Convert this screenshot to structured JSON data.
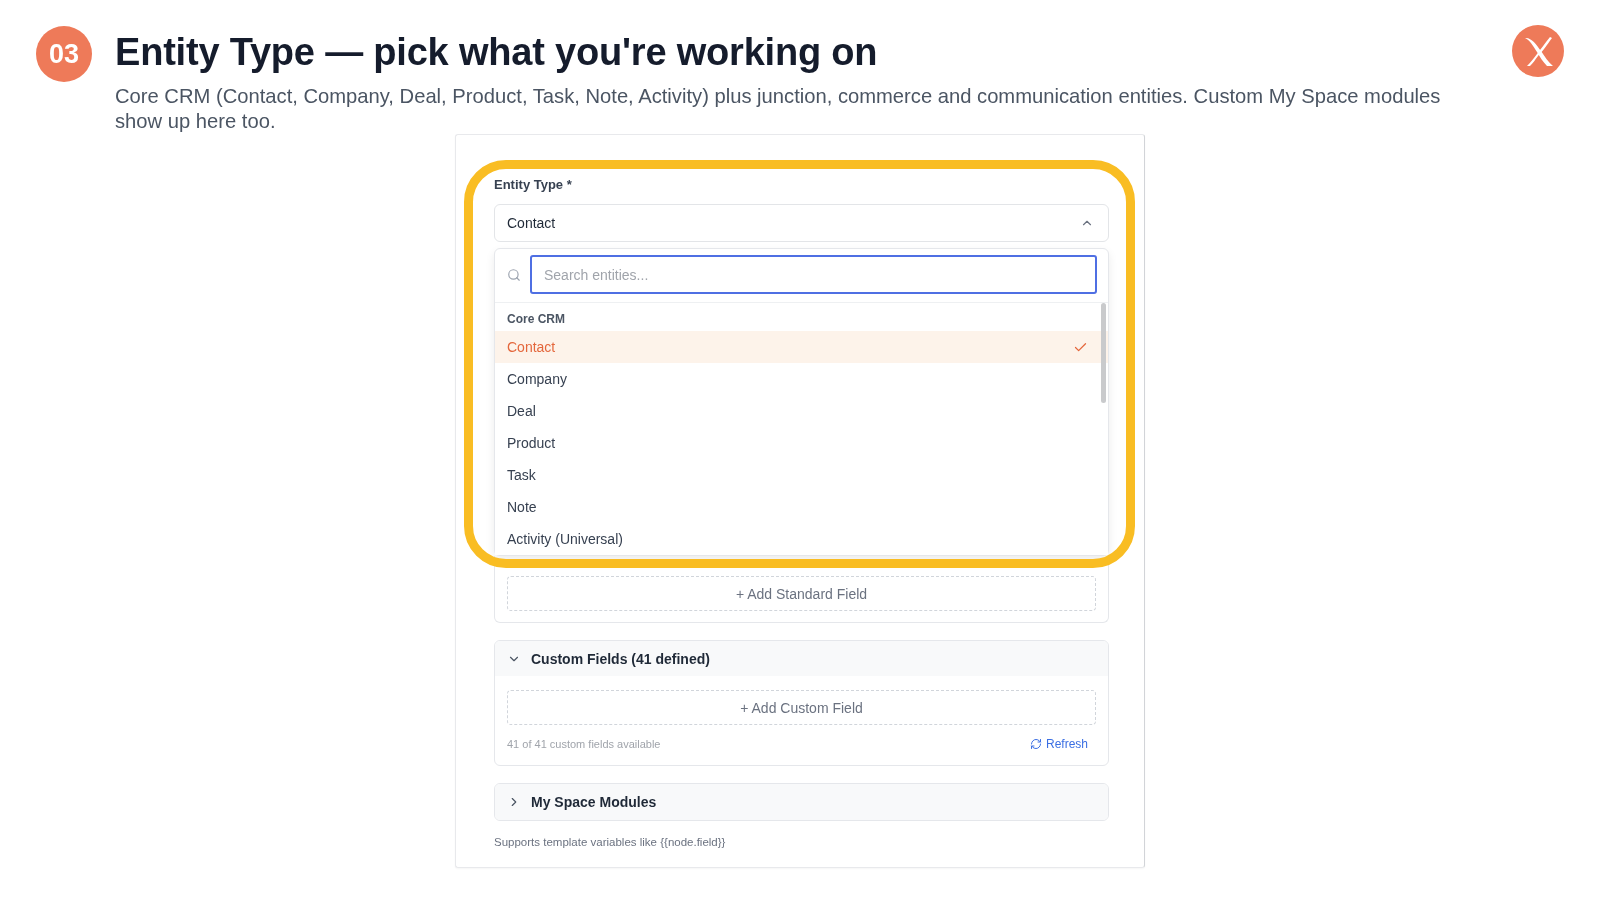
{
  "header": {
    "step": "03",
    "title": "Entity Type — pick what you're working on",
    "description": "Core CRM (Contact, Company, Deal, Product, Task, Note, Activity) plus junction, commerce and communication entities. Custom My Space modules show up here too."
  },
  "form": {
    "entity_type": {
      "label": "Entity Type *",
      "value": "Contact",
      "expanded": true,
      "search": {
        "placeholder": "Search entities..."
      },
      "groups": [
        {
          "label": "Core CRM",
          "options": [
            {
              "label": "Contact",
              "selected": true
            },
            {
              "label": "Company",
              "selected": false
            },
            {
              "label": "Deal",
              "selected": false
            },
            {
              "label": "Product",
              "selected": false
            },
            {
              "label": "Task",
              "selected": false
            },
            {
              "label": "Note",
              "selected": false
            },
            {
              "label": "Activity (Universal)",
              "selected": false
            }
          ]
        }
      ]
    },
    "standard_fields": {
      "add_button": "+ Add Standard Field"
    },
    "sections": [
      {
        "title": "Custom Fields (41 defined)",
        "expanded": true,
        "add_button": "+ Add Custom Field",
        "status": "41 of 41 custom fields available",
        "refresh": "Refresh"
      },
      {
        "title": "My Space Modules",
        "expanded": false
      }
    ],
    "hint": "Supports template variables like {{node.field}}"
  }
}
